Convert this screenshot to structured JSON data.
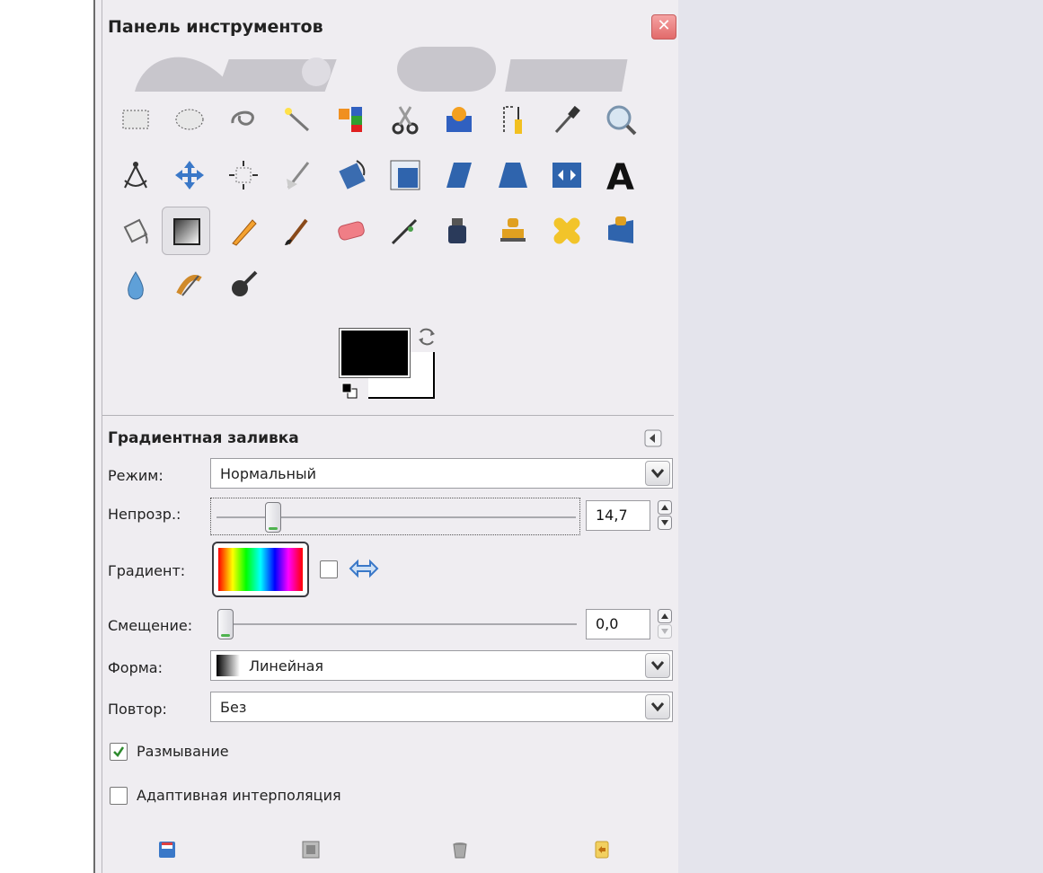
{
  "window": {
    "title": "Панель инструментов",
    "close_label": "✕"
  },
  "tools": [
    {
      "icon": "rect-select-icon"
    },
    {
      "icon": "ellipse-select-icon"
    },
    {
      "icon": "free-select-icon"
    },
    {
      "icon": "fuzzy-select-icon"
    },
    {
      "icon": "select-by-color-icon"
    },
    {
      "icon": "scissors-select-icon"
    },
    {
      "icon": "foreground-select-icon"
    },
    {
      "icon": "paths-icon"
    },
    {
      "icon": "color-picker-icon"
    },
    {
      "icon": "zoom-icon"
    },
    {
      "icon": "measure-icon"
    },
    {
      "icon": "move-icon"
    },
    {
      "icon": "align-icon"
    },
    {
      "icon": "crop-icon"
    },
    {
      "icon": "rotate-icon"
    },
    {
      "icon": "scale-icon"
    },
    {
      "icon": "shear-icon"
    },
    {
      "icon": "perspective-icon"
    },
    {
      "icon": "flip-icon"
    },
    {
      "icon": "text-icon"
    },
    {
      "icon": "bucket-fill-icon"
    },
    {
      "icon": "blend-icon",
      "active": true
    },
    {
      "icon": "pencil-icon"
    },
    {
      "icon": "paintbrush-icon"
    },
    {
      "icon": "eraser-icon"
    },
    {
      "icon": "airbrush-icon"
    },
    {
      "icon": "ink-icon"
    },
    {
      "icon": "clone-icon"
    },
    {
      "icon": "heal-icon"
    },
    {
      "icon": "perspective-clone-icon"
    },
    {
      "icon": "blur-icon"
    },
    {
      "icon": "smudge-icon"
    },
    {
      "icon": "dodge-burn-icon"
    }
  ],
  "colors": {
    "foreground": "#000000",
    "background": "#ffffff"
  },
  "options": {
    "title": "Градиентная заливка",
    "mode": {
      "label": "Режим:",
      "value": "Нормальный"
    },
    "opacity": {
      "label": "Непрозр.:",
      "value": "14,7",
      "fraction": 0.147
    },
    "gradient": {
      "label": "Градиент:"
    },
    "offset": {
      "label": "Смещение:",
      "value": "0,0",
      "fraction": 0.0
    },
    "shape": {
      "label": "Форма:",
      "value": "Линейная"
    },
    "repeat": {
      "label": "Повтор:",
      "value": "Без"
    },
    "dither": {
      "label": "Размывание",
      "checked": true
    },
    "adaptive": {
      "label": "Адаптивная интерполяция",
      "checked": false
    }
  },
  "bottom_icons": [
    "save-options-icon",
    "restore-options-icon",
    "delete-options-icon",
    "reset-options-icon"
  ],
  "theme": {
    "accent_green": "#4fb34f",
    "close_red": "#e26a6a"
  }
}
